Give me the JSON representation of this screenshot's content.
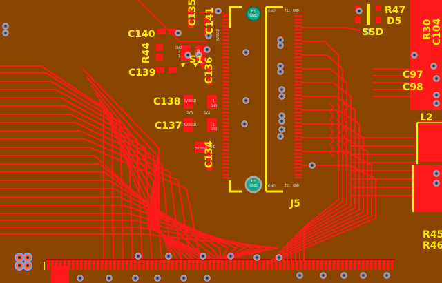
{
  "colors": {
    "board": "#8a4500",
    "copper": "#ff1a1a",
    "copper_dark": "#c40000",
    "silkscreen": "#ffee00",
    "via": "#8a8aa8",
    "mount_hole": "#1aa58a",
    "pad_gray": "#9b9b9b"
  },
  "designators": {
    "c140": "C140",
    "r44": "R44",
    "c139": "C139",
    "c135": "C135",
    "c141": "C141",
    "s1": "S1",
    "c136": "C136",
    "c138": "C138",
    "c137": "C137",
    "c134": "C134",
    "j5": "J5",
    "r47": "R47",
    "d5": "D5",
    "ssd": "SSD",
    "r30": "R30",
    "c104": "C104",
    "c97": "C97",
    "c98": "C98",
    "l2": "L2",
    "r45": "R45",
    "r46": "R46"
  },
  "connector": {
    "top_gnd": "GND",
    "top_t1": "T1: GND",
    "bottom_gnd": "GND",
    "bottom_t2": "T2: GND",
    "h1": "H1",
    "h2": "H2",
    "hole_net": "GND"
  },
  "pin_labels": {
    "p3v3ssd_a": "3V3SSD",
    "p3v3ssd_b": "3V3SSD",
    "p3v3ssd_c": "3V3SSD",
    "p3v3ssd_d": "3V3SSD",
    "pgnd_a": "GND",
    "pgnd_b": "GND",
    "pgnd_c": "GND",
    "pgnd_d": "GND",
    "pgnd_e": "GND",
    "p1_a": "1",
    "p1_b": "1",
    "p1_c": "1",
    "p2_a": "2",
    "p3v3_a": "3V3",
    "p3v3_b": "3V3"
  }
}
